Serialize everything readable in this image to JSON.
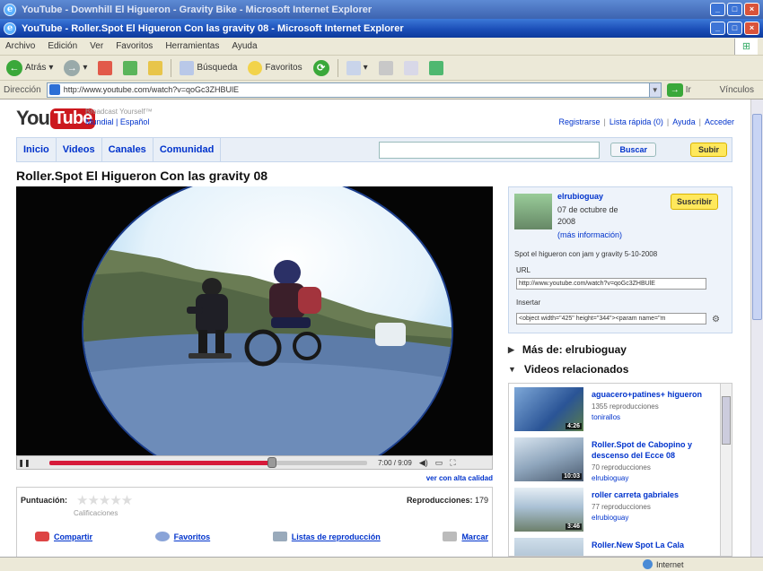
{
  "window_back": {
    "title": "YouTube - Downhill El Higueron - Gravity Bike - Microsoft Internet Explorer"
  },
  "window": {
    "title": "YouTube - Roller.Spot El Higueron Con las gravity 08 - Microsoft Internet Explorer"
  },
  "menu": [
    "Archivo",
    "Edición",
    "Ver",
    "Favoritos",
    "Herramientas",
    "Ayuda"
  ],
  "toolbar": {
    "back": "Atrás",
    "search": "Búsqueda",
    "favorites": "Favoritos"
  },
  "address": {
    "label": "Dirección",
    "url": "http://www.youtube.com/watch?v=qoGc3ZHBUlE",
    "go": "Ir",
    "links": "Vínculos"
  },
  "yt": {
    "logo_you": "You",
    "logo_tube": "Tube",
    "tagline": "Broadcast Yourself™",
    "lang_country": "Mundial",
    "lang_language": "Español",
    "top_links": [
      "Registrarse",
      "Lista rápida (0)",
      "Ayuda",
      "Acceder"
    ],
    "nav": [
      "Inicio",
      "Videos",
      "Canales",
      "Comunidad"
    ],
    "search_button": "Buscar",
    "upload_button": "Subir"
  },
  "video": {
    "title": "Roller.Spot El Higueron Con las gravity 08",
    "time": "7:00 / 9:09",
    "progress": 0.7,
    "hq": "ver con alta calidad",
    "rating_label": "Puntuación:",
    "ratings_text": "Calificaciones",
    "views_label": "Reproducciones:",
    "views": "179",
    "actions": [
      "Compartir",
      "Favoritos",
      "Listas de reproducción",
      "Marcar"
    ]
  },
  "uploader": {
    "name": "elrubioguay",
    "date_line1": "07 de octubre de",
    "date_line2": "2008",
    "more": "(más información)",
    "subscribe": "Suscribir",
    "description": "Spot el higueron con jam y gravity 5-10-2008",
    "url_label": "URL",
    "url_value": "http://www.youtube.com/watch?v=qoGc3ZHBUlE",
    "embed_label": "Insertar",
    "embed_value": "<object width=\"425\" height=\"344\"><param name=\"m"
  },
  "side": {
    "more_from": "Más de: elrubioguay",
    "related_header": "Videos relacionados"
  },
  "related": [
    {
      "title": "aguacero+patines+ higueron",
      "views": "1355 reproducciones",
      "user": "tonirallos",
      "duration": "4:26"
    },
    {
      "title": "Roller.Spot de Cabopino y descenso del Ecce 08",
      "views": "70 reproducciones",
      "user": "elrubioguay",
      "duration": "10:03"
    },
    {
      "title": "roller carreta gabriales",
      "views": "77 reproducciones",
      "user": "elrubioguay",
      "duration": "3:46"
    },
    {
      "title": "Roller.New Spot La Cala",
      "views": "",
      "user": "",
      "duration": ""
    }
  ],
  "status": {
    "zone": "Internet"
  },
  "colors": {
    "yt_red": "#cc181e",
    "link": "#0033cc",
    "progress": "#d61a3a",
    "button_yellow": "#ffe85c"
  }
}
